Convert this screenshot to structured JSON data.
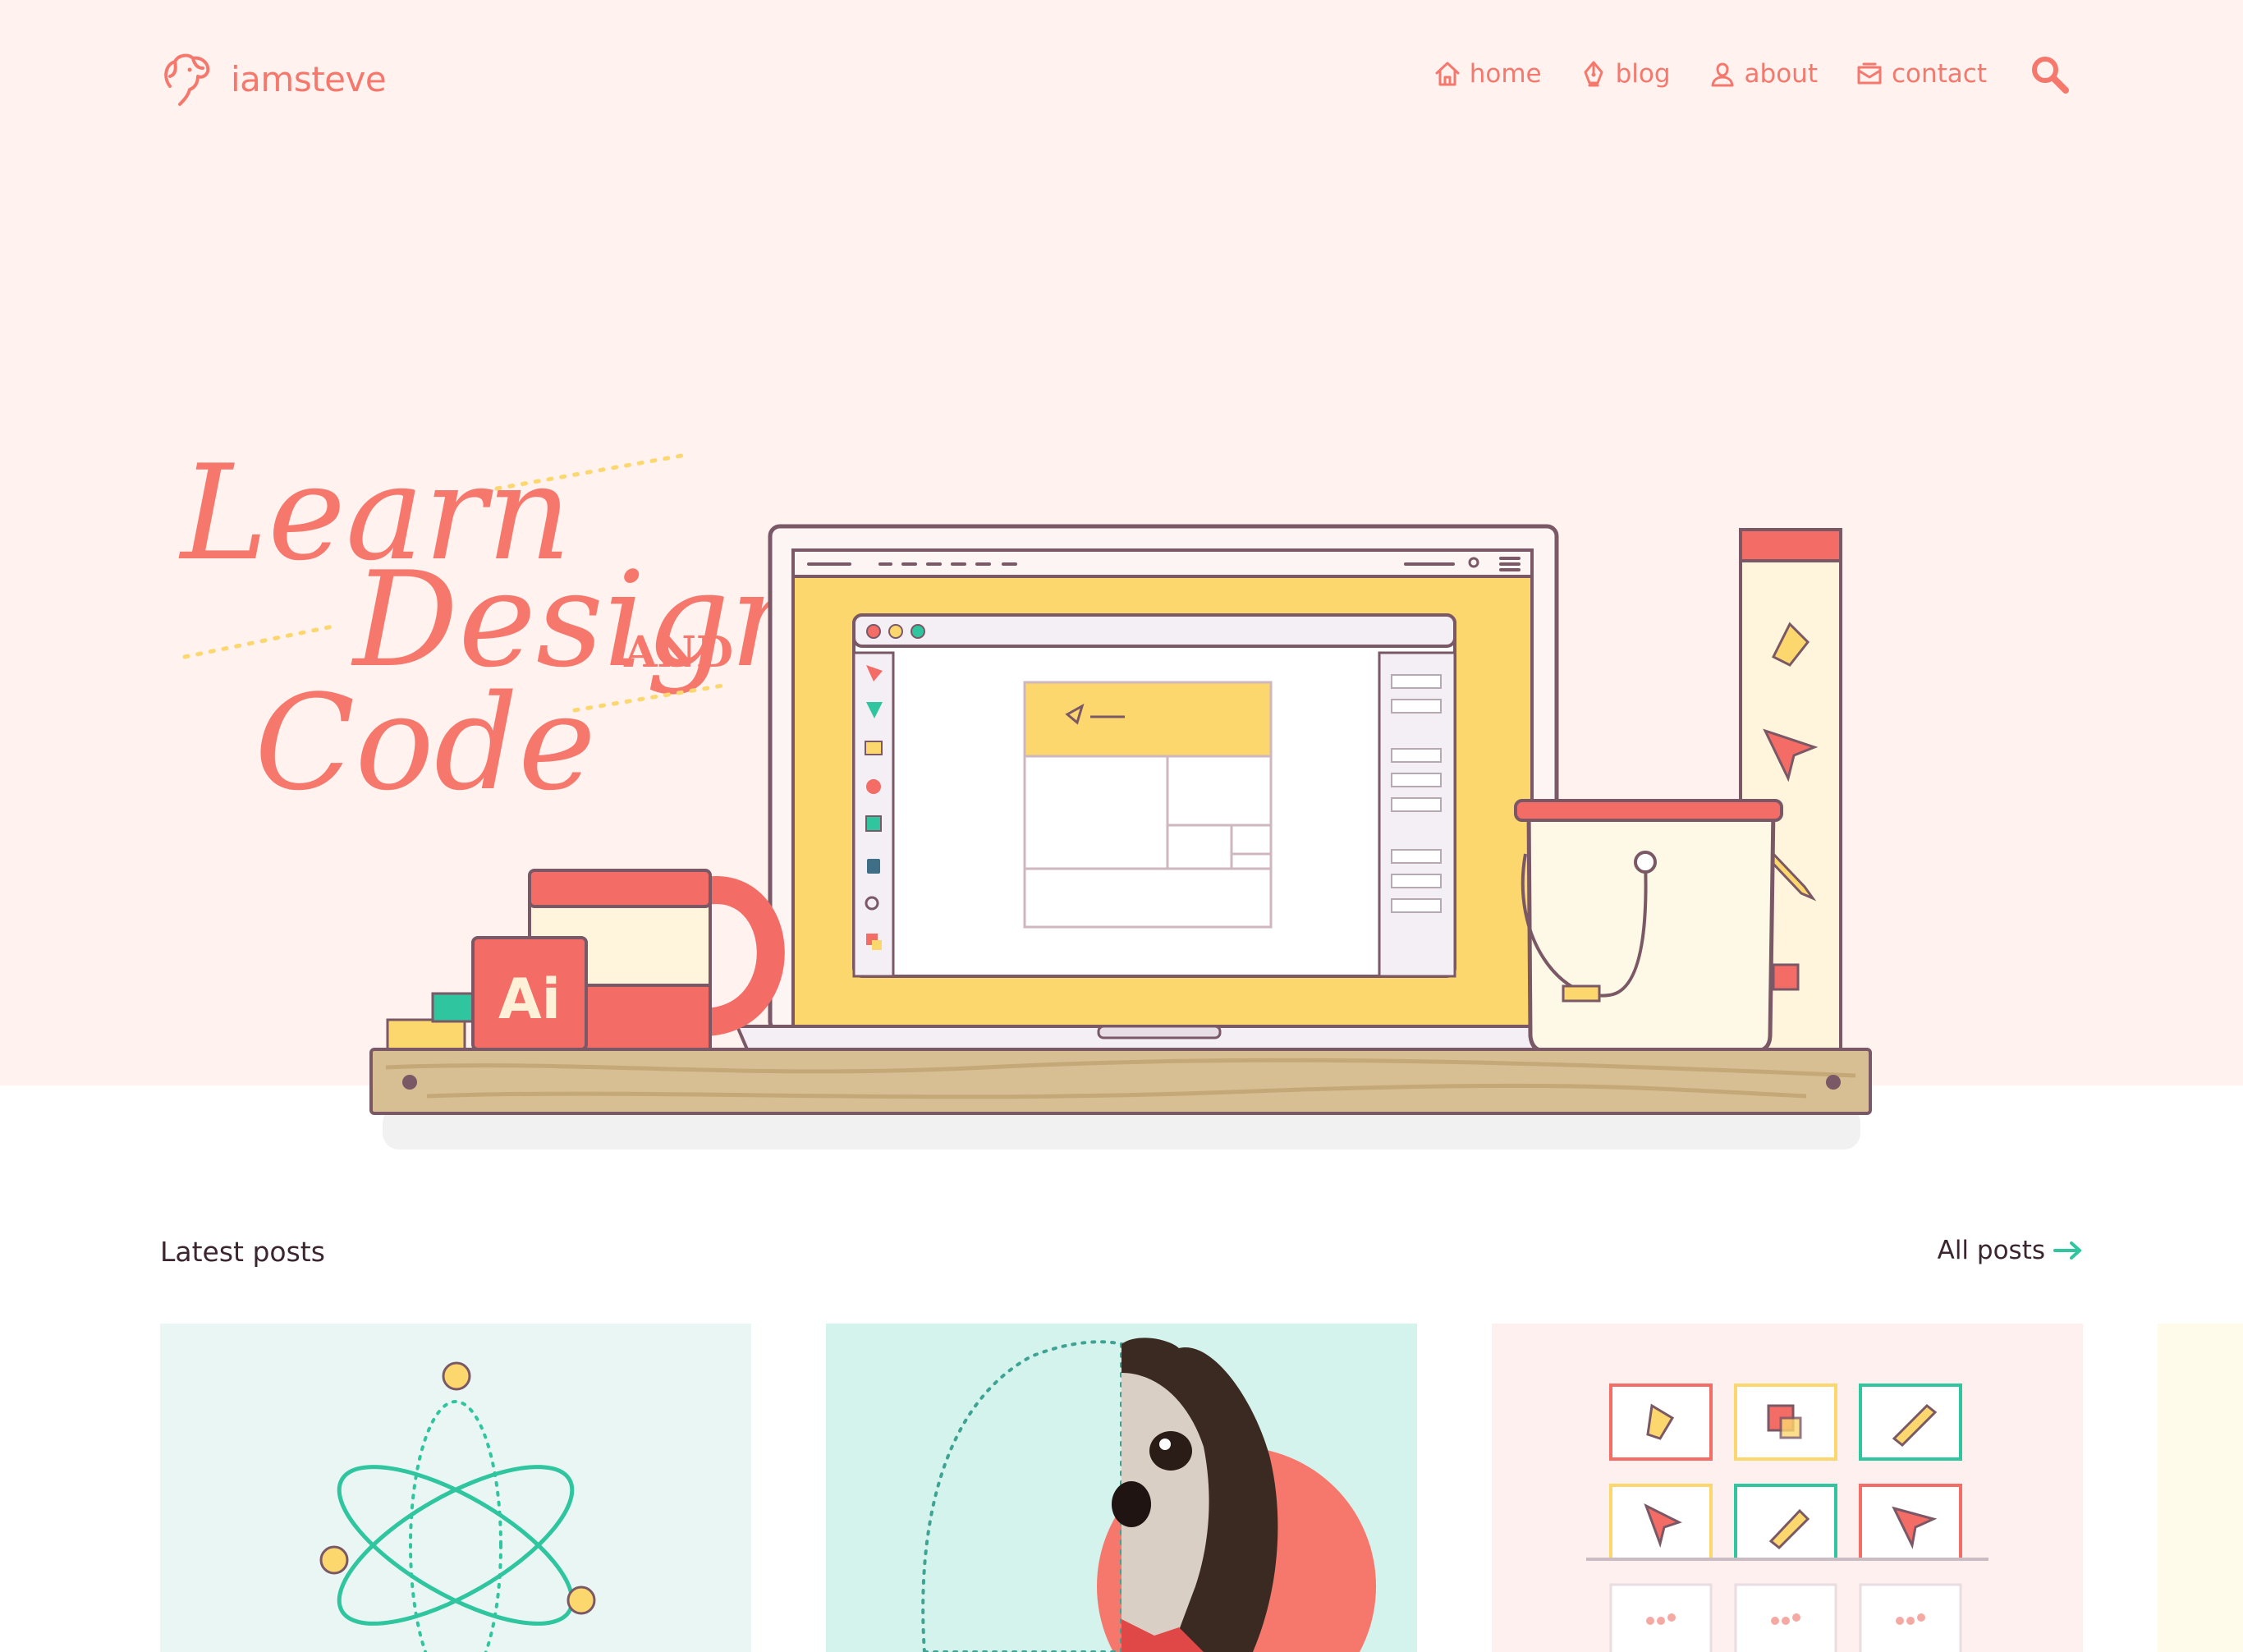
{
  "site": {
    "logo_text": "iamsteve"
  },
  "nav": {
    "items": [
      {
        "label": "home",
        "icon": "home-icon"
      },
      {
        "label": "blog",
        "icon": "pen-nib-icon"
      },
      {
        "label": "about",
        "icon": "user-icon"
      },
      {
        "label": "contact",
        "icon": "mail-icon"
      }
    ],
    "search_icon": "search-icon"
  },
  "hero": {
    "lettering": {
      "line1": "Learn",
      "line2": "Design",
      "and": "AND",
      "line3": "Code"
    },
    "ai_badge": "Ai"
  },
  "latest": {
    "title": "Latest posts",
    "all_label": "All posts",
    "all_icon": "arrow-right-icon"
  },
  "colors": {
    "brand": "#f6786d",
    "hero_bg": "#fff2ef",
    "teal": "#2fc59f",
    "yellow": "#fcd76e",
    "dark": "#3b2630"
  }
}
